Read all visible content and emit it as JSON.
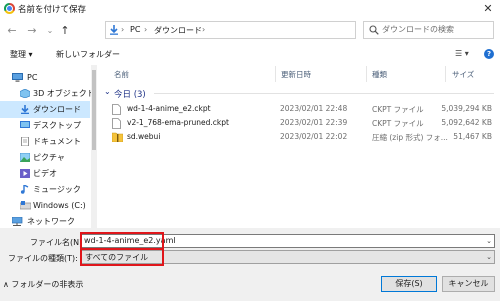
{
  "window": {
    "title": "名前を付けて保存",
    "close_glyph": "✕"
  },
  "nav": {
    "back_glyph": "←",
    "forward_glyph": "→",
    "history_glyph": "⌄",
    "up_glyph": "↑",
    "breadcrumb": [
      "PC",
      "ダウンロード"
    ],
    "breadcrumb_sep": "›",
    "address_dropdown_glyph": "⌄",
    "refresh_glyph": "↻",
    "search_placeholder": "ダウンロードの検索"
  },
  "toolbar": {
    "organize_label": "整理 ▾",
    "new_folder_label": "新しいフォルダー",
    "view_glyph": "☰ ▾",
    "help_glyph": "?"
  },
  "sidebar": {
    "items": [
      {
        "label": "PC",
        "icon": "pc-icon",
        "indent": 0,
        "selected": false
      },
      {
        "label": "3D オブジェクト",
        "icon": "3d-objects-icon",
        "indent": 1,
        "selected": false
      },
      {
        "label": "ダウンロード",
        "icon": "download-icon",
        "indent": 1,
        "selected": true
      },
      {
        "label": "デスクトップ",
        "icon": "desktop-icon",
        "indent": 1,
        "selected": false
      },
      {
        "label": "ドキュメント",
        "icon": "documents-icon",
        "indent": 1,
        "selected": false
      },
      {
        "label": "ピクチャ",
        "icon": "pictures-icon",
        "indent": 1,
        "selected": false
      },
      {
        "label": "ビデオ",
        "icon": "videos-icon",
        "indent": 1,
        "selected": false
      },
      {
        "label": "ミュージック",
        "icon": "music-icon",
        "indent": 1,
        "selected": false
      },
      {
        "label": "Windows (C:)",
        "icon": "drive-icon",
        "indent": 1,
        "selected": false
      },
      {
        "label": "ネットワーク",
        "icon": "network-icon",
        "indent": 0,
        "selected": false
      }
    ]
  },
  "filelist": {
    "columns": {
      "name": "名前",
      "date": "更新日時",
      "type": "種類",
      "size": "サイズ"
    },
    "group_label": "今日 (3)",
    "group_chevron": "⌄",
    "rows": [
      {
        "name": "wd-1-4-anime_e2.ckpt",
        "date": "2023/02/01 22:48",
        "type": "CKPT ファイル",
        "size": "5,039,294 KB",
        "icon": "file-icon"
      },
      {
        "name": "v2-1_768-ema-pruned.ckpt",
        "date": "2023/02/01 22:39",
        "type": "CKPT ファイル",
        "size": "5,092,642 KB",
        "icon": "file-icon"
      },
      {
        "name": "sd.webui",
        "date": "2023/02/01 22:02",
        "type": "圧縮 (zip 形式) フォ...",
        "size": "51,467 KB",
        "icon": "zip-folder-icon"
      }
    ]
  },
  "form": {
    "filename_label": "ファイル名(N):",
    "filename_value": "wd-1-4-anime_e2.yaml",
    "filetype_label": "ファイルの種類(T):",
    "filetype_value": "すべてのファイル",
    "dropdown_glyph": "⌄"
  },
  "footer": {
    "hide_folders_label": "∧  フォルダーの非表示",
    "save_label": "保存(S)",
    "cancel_label": "キャンセル"
  },
  "colors": {
    "highlight_red": "#e0161b",
    "selection_blue": "#cce8ff",
    "accent_blue": "#0078d7"
  }
}
